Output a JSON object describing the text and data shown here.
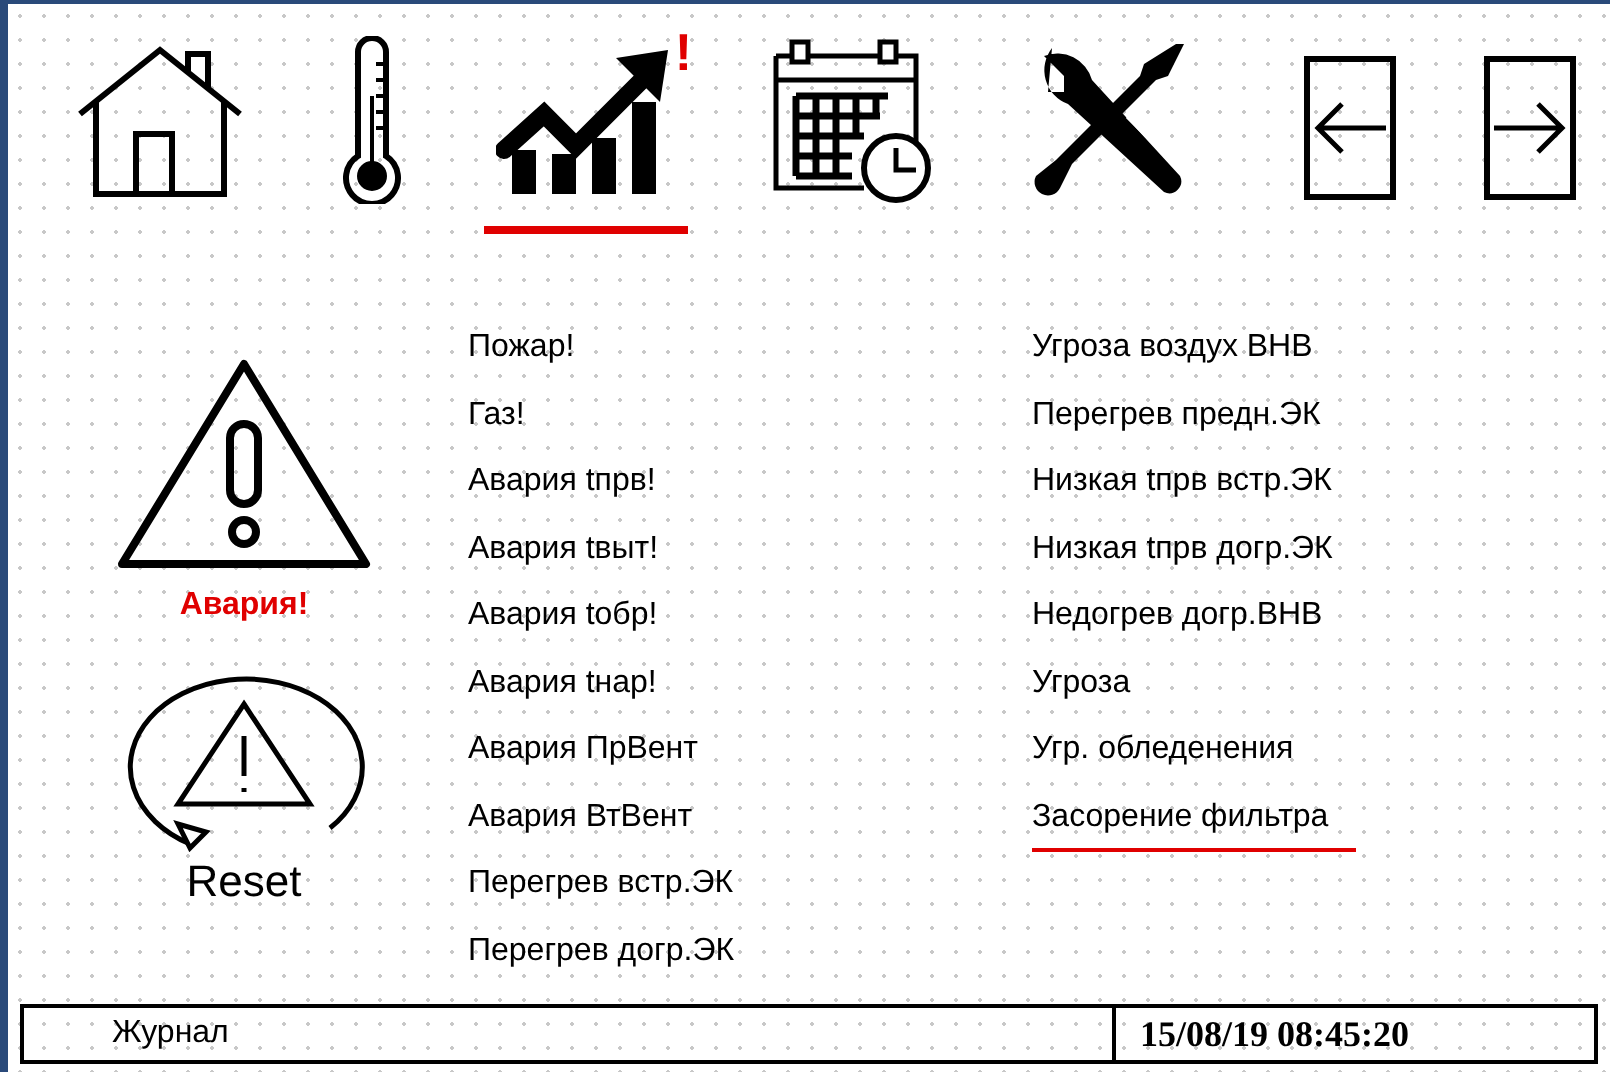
{
  "nav": [
    {
      "kind": "home",
      "selected": false
    },
    {
      "kind": "thermometer",
      "selected": false
    },
    {
      "kind": "chart",
      "selected": true,
      "badge": "!"
    },
    {
      "kind": "calendar",
      "selected": false
    },
    {
      "kind": "tools",
      "selected": false
    },
    {
      "kind": "back"
    },
    {
      "kind": "forward"
    }
  ],
  "alarm": {
    "label": "Авария!"
  },
  "reset": {
    "label": "Reset"
  },
  "alarms_left": [
    {
      "text": "Пожар!",
      "selected": false
    },
    {
      "text": "Газ!",
      "selected": false
    },
    {
      "text": "Авария tпрв!",
      "selected": false
    },
    {
      "text": "Авария tвыт!",
      "selected": false
    },
    {
      "text": "Авария tобр!",
      "selected": false
    },
    {
      "text": "Авария tнар!",
      "selected": false
    },
    {
      "text": "Авария ПрВент",
      "selected": false
    },
    {
      "text": "Авария ВтВент",
      "selected": false
    },
    {
      "text": "Перегрев встр.ЭК",
      "selected": false
    },
    {
      "text": "Перегрев догр.ЭК",
      "selected": false
    }
  ],
  "alarms_right": [
    {
      "text": "Угроза воздух ВНВ",
      "selected": false
    },
    {
      "text": "Перегрев предн.ЭК",
      "selected": false
    },
    {
      "text": "Низкая tпрв встр.ЭК",
      "selected": false
    },
    {
      "text": "Низкая tпрв догр.ЭК",
      "selected": false
    },
    {
      "text": "Недогрев догр.ВНВ",
      "selected": false
    },
    {
      "text": "Угроза",
      "selected": false
    },
    {
      "text": "Угр. обледенения",
      "selected": false
    },
    {
      "text": "Засорение фильтра",
      "selected": true
    }
  ],
  "status_bar": {
    "journal": "Журнал",
    "datetime": "15/08/19 08:45:20"
  }
}
